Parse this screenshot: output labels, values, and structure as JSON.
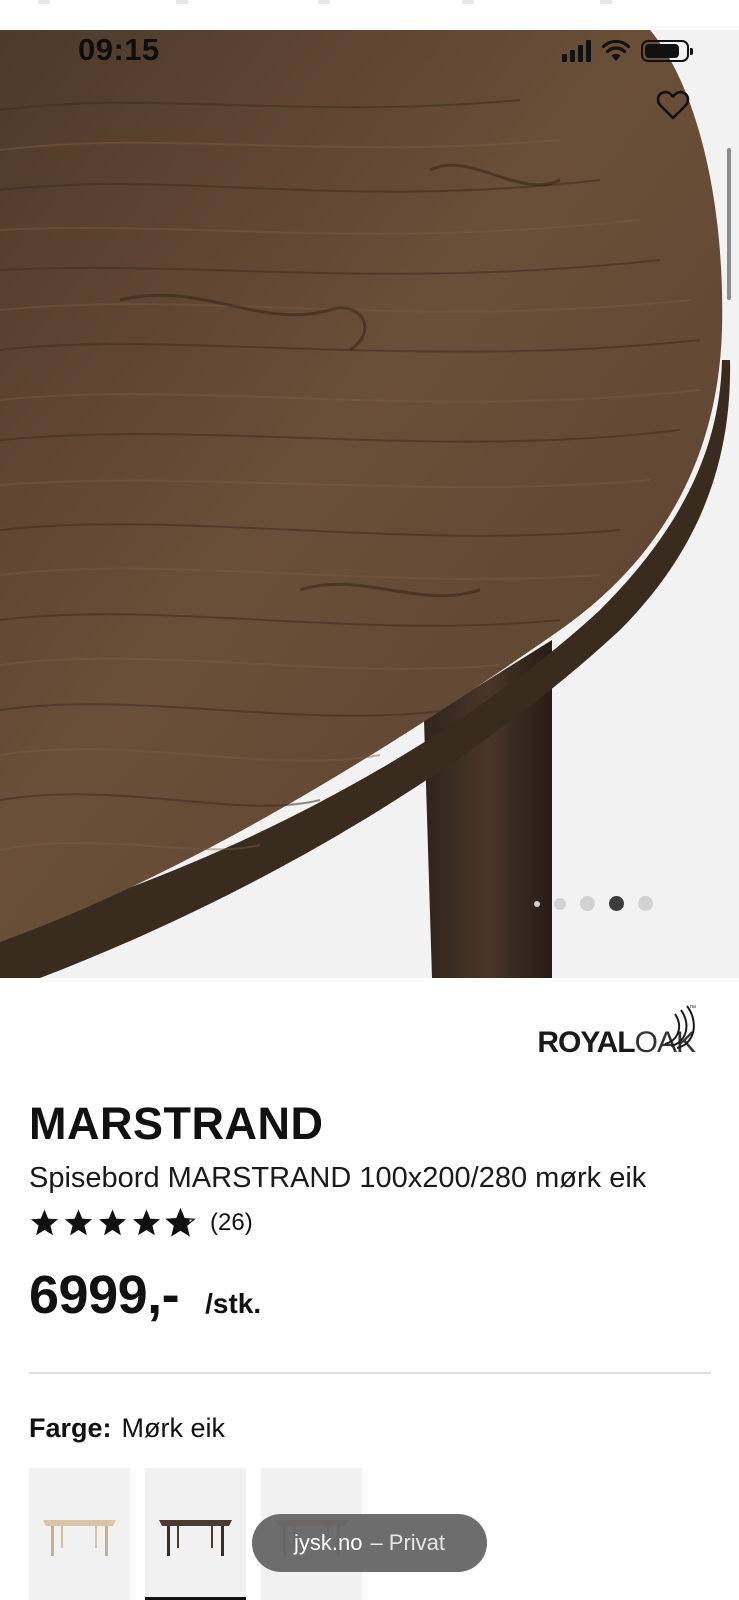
{
  "status_bar": {
    "time": "09:15",
    "icons": [
      "cellular-signal-icon",
      "wifi-icon",
      "battery-icon"
    ]
  },
  "gallery": {
    "image_alt": "Spisebord MARSTRAND mørk eik",
    "page_count": 5,
    "active_index": 3,
    "favorite_icon": "heart-outline-icon"
  },
  "brand": {
    "strong": "ROYAL",
    "light": "OAK",
    "tm": "™"
  },
  "product": {
    "name": "MARSTRAND",
    "description": "Spisebord MARSTRAND 100x200/280 mørk eik",
    "rating": 4.8,
    "rating_max": 5,
    "rating_count": "(26)",
    "price": "6999,-",
    "price_unit": "/stk."
  },
  "color": {
    "label": "Farge:",
    "value": "Mørk eik",
    "swatches": [
      {
        "name": "Lys eik",
        "color": "#d8c3a5",
        "selected": false
      },
      {
        "name": "Mørk eik",
        "color": "#4a3a30",
        "selected": true
      },
      {
        "name": "Natur",
        "color": "#b07a4c",
        "selected": false
      }
    ]
  },
  "browser": {
    "domain": "jysk.no",
    "mode": "– Privat"
  },
  "colors": {
    "text": "#111111",
    "hero_bg": "#f3f2f2",
    "wood": "#5c4431",
    "divider": "#dcdcdc",
    "toast_bg": "#666666"
  }
}
